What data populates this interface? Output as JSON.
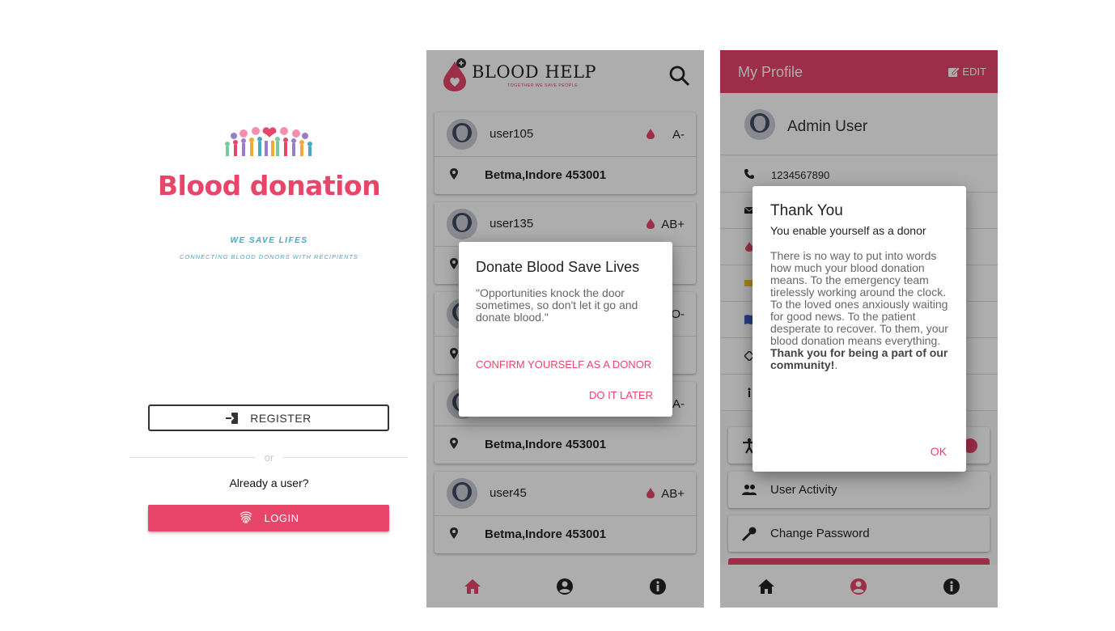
{
  "colors": {
    "accent": "#e8456a",
    "blood_help_accent": "#e8456a",
    "tagline": "#4aa6c4",
    "overlay": "rgba(0,0,0,0.32)"
  },
  "login": {
    "logo_title": "Blood donation",
    "tagline": "WE SAVE LIFES",
    "subtitle": "CONNECTING BLOOD DONORS WITH RECIPIENTS",
    "register_label": "REGISTER",
    "or_label": "or",
    "already_user": "Already a user?",
    "login_label": "LOGIN"
  },
  "donors": {
    "brand_title": "BLOOD HELP",
    "brand_sub": "TOGETHER WE SAVE PEOPLE",
    "cards": [
      {
        "name": "user105",
        "blood": "A-",
        "address": "Betma,Indore 453001"
      },
      {
        "name": "user135",
        "blood": "AB+",
        "address": ""
      },
      {
        "name": "",
        "blood": "O-",
        "address": ""
      },
      {
        "name": "",
        "blood": "A-",
        "address": "Betma,Indore 453001"
      },
      {
        "name": "user45",
        "blood": "AB+",
        "address": "Betma,Indore 453001"
      }
    ],
    "dialog": {
      "title": "Donate Blood Save Lives",
      "body": "\"Opportunities knock the door sometimes, so don't let it go and donate blood.\"",
      "confirm_label": "CONFIRM YOURSELF AS A DONOR",
      "later_label": "DO IT LATER"
    },
    "nav": [
      "home-icon",
      "account-icon",
      "info-icon"
    ]
  },
  "profile": {
    "title": "My Profile",
    "edit_label": "EDIT",
    "user_name": "Admin User",
    "phone": "1234567890",
    "activity_label": "User Activity",
    "password_label": "Change Password",
    "dialog": {
      "title": "Thank You",
      "subtitle": "You enable yourself as a donor",
      "body": "There is no way to put into words how much your blood donation means. To the emergency team tirelessly working around the clock. To the loved ones anxiously waiting for good news. To the patient desperate to recover. To them, your blood donation means everything. ",
      "body_bold": "Thank you for being a part of our community!",
      "body_end": ".",
      "ok_label": "OK"
    },
    "nav": [
      "home-icon",
      "account-icon",
      "info-icon"
    ]
  }
}
